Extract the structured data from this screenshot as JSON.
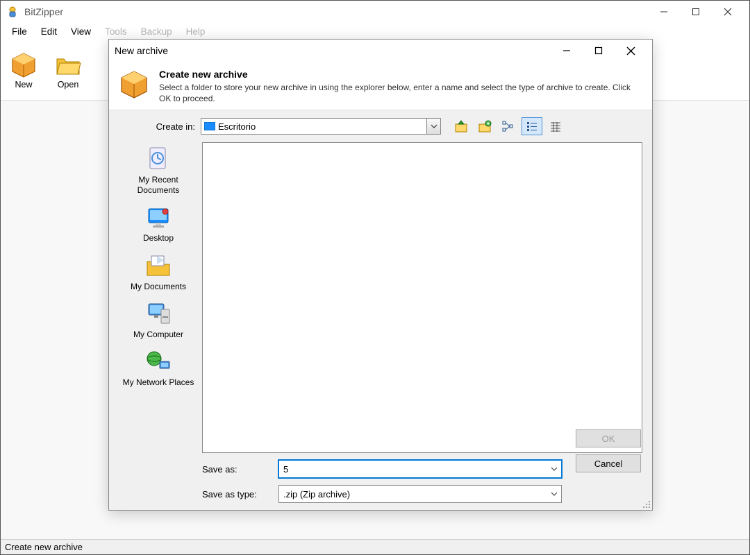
{
  "app": {
    "title": "BitZipper"
  },
  "menu": {
    "items": [
      "File",
      "Edit",
      "View",
      "Tools",
      "Backup",
      "Help"
    ]
  },
  "toolbar": {
    "items": [
      {
        "label": "New"
      },
      {
        "label": "Open"
      }
    ]
  },
  "statusbar": {
    "text": "Create new archive"
  },
  "dialog": {
    "title": "New archive",
    "header": {
      "heading": "Create new archive",
      "desc": "Select a folder to store your new archive in using the explorer below, enter a name and select the type of archive to create. Click OK to proceed."
    },
    "create_in": {
      "label": "Create in:",
      "value": "Escritorio"
    },
    "places": [
      {
        "label": "My Recent Documents"
      },
      {
        "label": "Desktop"
      },
      {
        "label": "My Documents"
      },
      {
        "label": "My Computer"
      },
      {
        "label": "My Network Places"
      }
    ],
    "save_as": {
      "label": "Save as:",
      "value": "5"
    },
    "save_type": {
      "label": "Save as type:",
      "value": ".zip (Zip archive)"
    },
    "buttons": {
      "ok": "OK",
      "cancel": "Cancel"
    }
  }
}
